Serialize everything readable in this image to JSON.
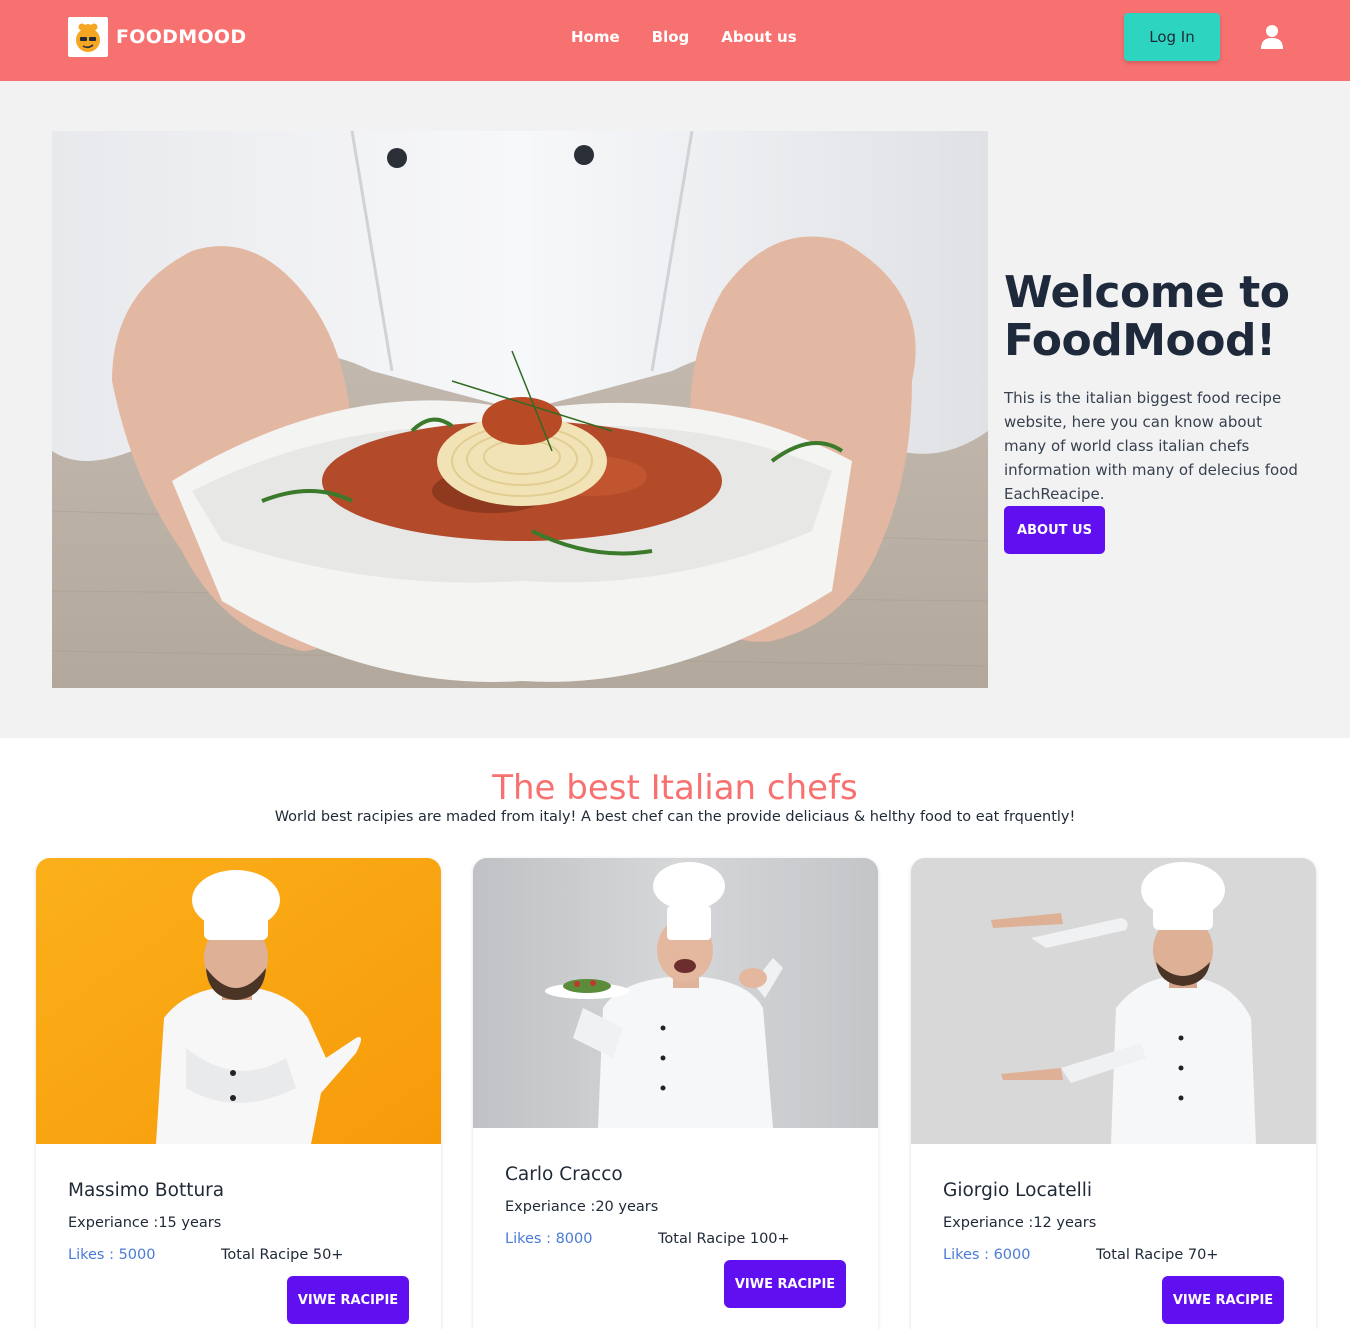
{
  "navbar": {
    "brand": "FOODMOOD",
    "links": [
      "Home",
      "Blog",
      "About us"
    ],
    "login_label": "Log In",
    "bg_color": "#f87171"
  },
  "hero": {
    "title": "Welcome to FoodMood!",
    "description": "This is the italian biggest food recipe website, here you can know about many of world class italian chefs information with many of delecius food EachReacipe.",
    "button_label": "ABOUT US"
  },
  "chefs_section": {
    "title": "The best Italian chefs",
    "subtitle": "World best racipies are maded from italy! A best chef can the provide deliciaus & helthy food to eat frquently!",
    "chefs": [
      {
        "name": "Massimo Bottura",
        "experience": "Experiance :15 years",
        "likes": "Likes : 5000",
        "total": "Total Racipe 50+",
        "button_label": "VIWE RACIPIE",
        "bg_color": "#f9a10c"
      },
      {
        "name": "Carlo Cracco",
        "experience": "Experiance :20 years",
        "likes": "Likes : 8000",
        "total": "Total Racipe 100+",
        "button_label": "VIWE RACIPIE",
        "bg_color": "#c9cbce"
      },
      {
        "name": "Giorgio Locatelli",
        "experience": "Experiance :12 years",
        "likes": "Likes : 6000",
        "total": "Total Racipe 70+",
        "button_label": "VIWE RACIPIE",
        "bg_color": "#d8d8d8"
      }
    ]
  },
  "colors": {
    "accent_purple": "#6010f0",
    "accent_teal": "#2dd4bf",
    "accent_coral": "#f87171",
    "link_blue": "#4a7bd6"
  }
}
